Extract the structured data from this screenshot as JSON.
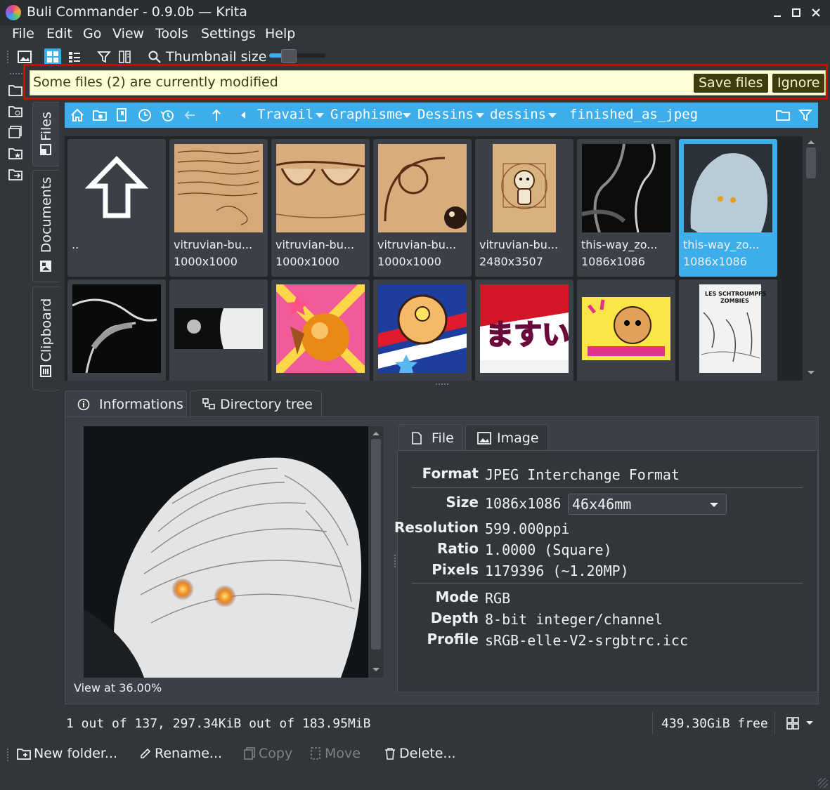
{
  "window": {
    "title": "Buli Commander - 0.9.0b — Krita"
  },
  "menu": [
    "File",
    "Edit",
    "Go",
    "View",
    "Tools",
    "Settings",
    "Help"
  ],
  "toolbar": {
    "thumbnail_size_label": "Thumbnail size",
    "thumbnail_size_level": 0.35
  },
  "side_tabs": {
    "files": "Files",
    "documents": "Documents",
    "clipboard": "Clipboard"
  },
  "notification": {
    "message": "Some files (2) are currently modified",
    "save_label": "Save files",
    "ignore_label": "Ignore"
  },
  "breadcrumb": [
    "Travail",
    "Graphisme",
    "Dessins",
    "dessins",
    "finished_as_jpeg"
  ],
  "thumbnails": [
    {
      "name": "..",
      "dims": ""
    },
    {
      "name": "vitruvian-bu...",
      "dims": "1000x1000"
    },
    {
      "name": "vitruvian-bu...",
      "dims": "1000x1000"
    },
    {
      "name": "vitruvian-bu...",
      "dims": "1000x1000"
    },
    {
      "name": "vitruvian-bu...",
      "dims": "2480x3507"
    },
    {
      "name": "this-way_zo...",
      "dims": "1086x1086"
    },
    {
      "name": "this-way_zo...",
      "dims": "1086x1086"
    }
  ],
  "info_tabs": {
    "informations": "Informations",
    "directory_tree": "Directory tree"
  },
  "preview": {
    "view_at": "View at 36.00%"
  },
  "prop_tabs": {
    "file": "File",
    "image": "Image"
  },
  "properties": {
    "format_label": "Format",
    "format_value": "JPEG Interchange Format",
    "size_label": "Size",
    "size_value": "1086x1086",
    "size_unit_select": "46x46mm",
    "resolution_label": "Resolution",
    "resolution_value": "599.000ppi",
    "ratio_label": "Ratio",
    "ratio_value": "1.0000 (Square)",
    "pixels_label": "Pixels",
    "pixels_value": "1179396 (~1.20MP)",
    "mode_label": "Mode",
    "mode_value": "RGB",
    "depth_label": "Depth",
    "depth_value": "8-bit integer/channel",
    "profile_label": "Profile",
    "profile_value": "sRGB-elle-V2-srgbtrc.icc"
  },
  "status": {
    "selection": "1 out of 137, 297.34KiB out of 183.95MiB",
    "free": "439.30GiB free"
  },
  "actions": {
    "new_folder": "New folder...",
    "rename": "Rename...",
    "copy": "Copy",
    "move": "Move",
    "delete": "Delete..."
  },
  "colors": {
    "accent": "#3daee9",
    "background": "#31363b",
    "notification_bg": "#fdfdd7",
    "highlight_outline": "#e00000"
  }
}
